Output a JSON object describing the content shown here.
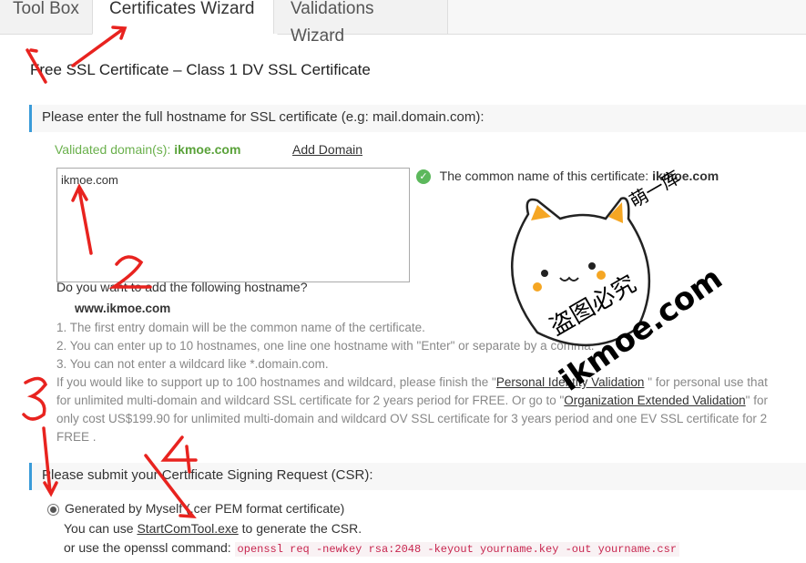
{
  "tabs": [
    "Tool Box",
    "Certificates Wizard",
    "Validations Wizard"
  ],
  "page_title": "Free SSL Certificate – Class 1 DV SSL Certificate",
  "section1": "Please enter the full hostname for SSL certificate (e.g: mail.domain.com):",
  "validated_label": "Validated domain(s):",
  "validated_domain": "ikmoe.com",
  "add_domain": "Add Domain",
  "hostname_value": "ikmoe.com",
  "common_name_label": "The common name of this certificate:",
  "common_name_value": "ikmoe.com",
  "add_question": "Do you want to add the following hostname?",
  "suggested_host": "www.ikmoe.com",
  "rules": [
    "1. The first entry domain will be the common name of the certificate.",
    "2. You can enter up to 10 hostnames, one line one hostname with \"Enter\" or separate by a comma.",
    "3. You can not enter a wildcard like *.domain.com."
  ],
  "more_pre": "If you would like to support up to 100 hostnames and wildcard, please finish the \"",
  "piv_link": "Personal Identity Validation",
  "more_mid": " \" for personal use that",
  "line2_pre": "for unlimited multi-domain and wildcard SSL certificate for 2 years period for FREE. Or go to \"",
  "oev_link": "Organization Extended Validation",
  "line2_post": "\" for",
  "line3": "only cost US$199.90 for unlimited multi-domain and wildcard OV SSL certificate for 3 years period and one EV SSL certificate for 2",
  "line4": "FREE .",
  "section2": "Please submit your Certificate Signing Request (CSR):",
  "radio_label": "Generated by Myself (.cer PEM format certificate)",
  "tool_pre": "You can use ",
  "tool_link": "StartComTool.exe",
  "tool_post": " to generate the CSR.",
  "openssl_label": "or use the openssl command:",
  "openssl_cmd": "openssl req -newkey rsa:2048 -keyout yourname.key -out yourname.csr",
  "annotations": [
    "1",
    "2",
    "3",
    "4"
  ],
  "watermark_cn": "萌一库",
  "watermark_url": "ikmoe.com",
  "watermark_cn2": "盗图必究",
  "colors": {
    "accent": "#3a9bd9",
    "annotation": "#e8231f",
    "success": "#5cb85c"
  }
}
